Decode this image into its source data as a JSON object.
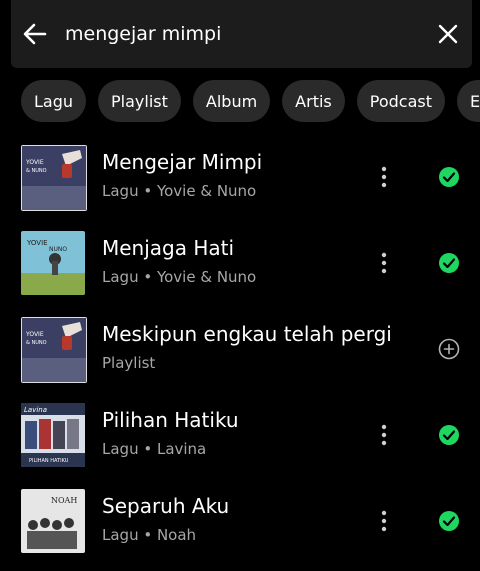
{
  "search": {
    "query": "mengejar mimpi",
    "back_icon": "arrow-left-icon",
    "clear_icon": "close-icon"
  },
  "filters": [
    "Lagu",
    "Playlist",
    "Album",
    "Artis",
    "Podcast",
    "Ep"
  ],
  "results": [
    {
      "title": "Mengejar Mimpi",
      "subtitle": "Lagu • Yovie & Nuno",
      "status": "added",
      "has_more": true
    },
    {
      "title": "Menjaga Hati",
      "subtitle": "Lagu • Yovie & Nuno",
      "status": "added",
      "has_more": true
    },
    {
      "title": "Meskipun engkau telah pergi",
      "subtitle": "Playlist",
      "status": "add",
      "has_more": false
    },
    {
      "title": "Pilihan Hatiku",
      "subtitle": "Lagu • Lavina",
      "status": "added",
      "has_more": true
    },
    {
      "title": "Separuh Aku",
      "subtitle": "Lagu • Noah",
      "status": "added",
      "has_more": true
    }
  ],
  "colors": {
    "background": "#000000",
    "search_bar": "#1c1c1c",
    "chip": "#2a2a2a",
    "subtitle": "#a7a7a7",
    "accent_green": "#1ed760"
  }
}
